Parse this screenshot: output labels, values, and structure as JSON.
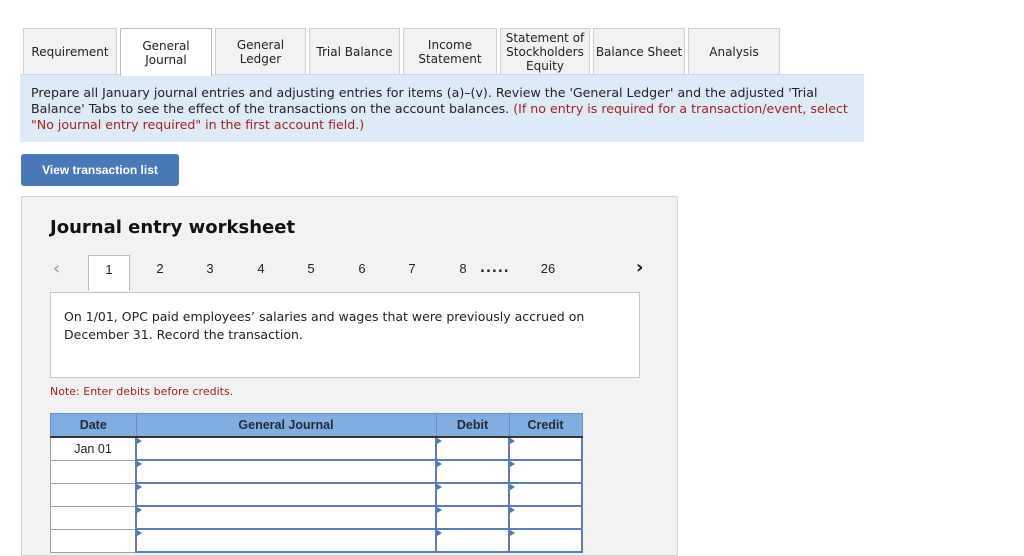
{
  "tabs": [
    {
      "label": "Requirement",
      "active": false
    },
    {
      "label": "General Journal",
      "active": true
    },
    {
      "label": "General Ledger",
      "active": false
    },
    {
      "label": "Trial Balance",
      "active": false
    },
    {
      "label": "Income Statement",
      "active": false
    },
    {
      "label": "Statement of Stockholders Equity",
      "active": false
    },
    {
      "label": "Balance Sheet",
      "active": false
    },
    {
      "label": "Analysis",
      "active": false
    }
  ],
  "instructions": {
    "text": "Prepare all January journal entries and adjusting entries for items (a)–(v). Review the 'General Ledger' and the adjusted 'Trial Balance' Tabs to see the effect of the transactions on the account balances.",
    "hint": "(If no entry is required for a transaction/event, select \"No journal entry required\" in the first account field.)"
  },
  "view_transaction_button": "View transaction list",
  "worksheet": {
    "title": "Journal entry worksheet",
    "pager": {
      "prev_icon": "‹",
      "next_icon": "›",
      "pages": [
        "1",
        "2",
        "3",
        "4",
        "5",
        "6",
        "7",
        "8"
      ],
      "ellipsis": ".....",
      "last_page": "26",
      "current": "1"
    },
    "question": "On 1/01, OPC paid employees’ salaries and wages that were previously accrued on December 31. Record the transaction.",
    "note": "Note: Enter debits before credits.",
    "table": {
      "headers": {
        "date": "Date",
        "account": "General Journal",
        "debit": "Debit",
        "credit": "Credit"
      },
      "rows": [
        {
          "date": "Jan 01",
          "account": "",
          "debit": "",
          "credit": ""
        },
        {
          "date": "",
          "account": "",
          "debit": "",
          "credit": ""
        },
        {
          "date": "",
          "account": "",
          "debit": "",
          "credit": ""
        },
        {
          "date": "",
          "account": "",
          "debit": "",
          "credit": ""
        },
        {
          "date": "",
          "account": "",
          "debit": "",
          "credit": ""
        }
      ]
    }
  }
}
